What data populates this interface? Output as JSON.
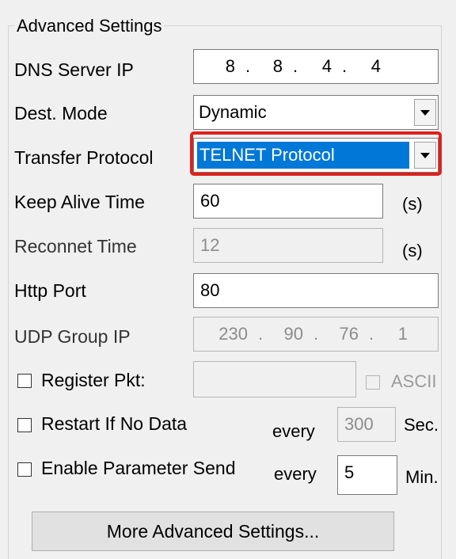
{
  "group_title": "Advanced Settings",
  "dns": {
    "label": "DNS Server IP",
    "octets": [
      "8",
      "8",
      "4",
      "4"
    ]
  },
  "dest_mode": {
    "label": "Dest. Mode",
    "value": "Dynamic"
  },
  "transfer_protocol": {
    "label": "Transfer Protocol",
    "value": "TELNET Protocol",
    "highlight_color": "#e0201b",
    "selection_color": "#0078d7"
  },
  "keep_alive": {
    "label": "Keep Alive Time",
    "value": "60",
    "unit": "(s)"
  },
  "reconnect": {
    "label": "Reconnet Time",
    "value": "12",
    "unit": "(s)"
  },
  "http_port": {
    "label": "Http Port",
    "value": "80"
  },
  "udp_group": {
    "label": "UDP Group IP",
    "octets": [
      "230",
      "90",
      "76",
      "1"
    ]
  },
  "register_pkt": {
    "label": "Register Pkt:",
    "value": "",
    "ascii_label": "ASCII"
  },
  "restart": {
    "label": "Restart If No Data",
    "every": "every",
    "value": "300",
    "unit": "Sec."
  },
  "param_send": {
    "label": "Enable Parameter Send",
    "every": "every",
    "value": "5",
    "unit": "Min."
  },
  "more_button": "More Advanced Settings..."
}
